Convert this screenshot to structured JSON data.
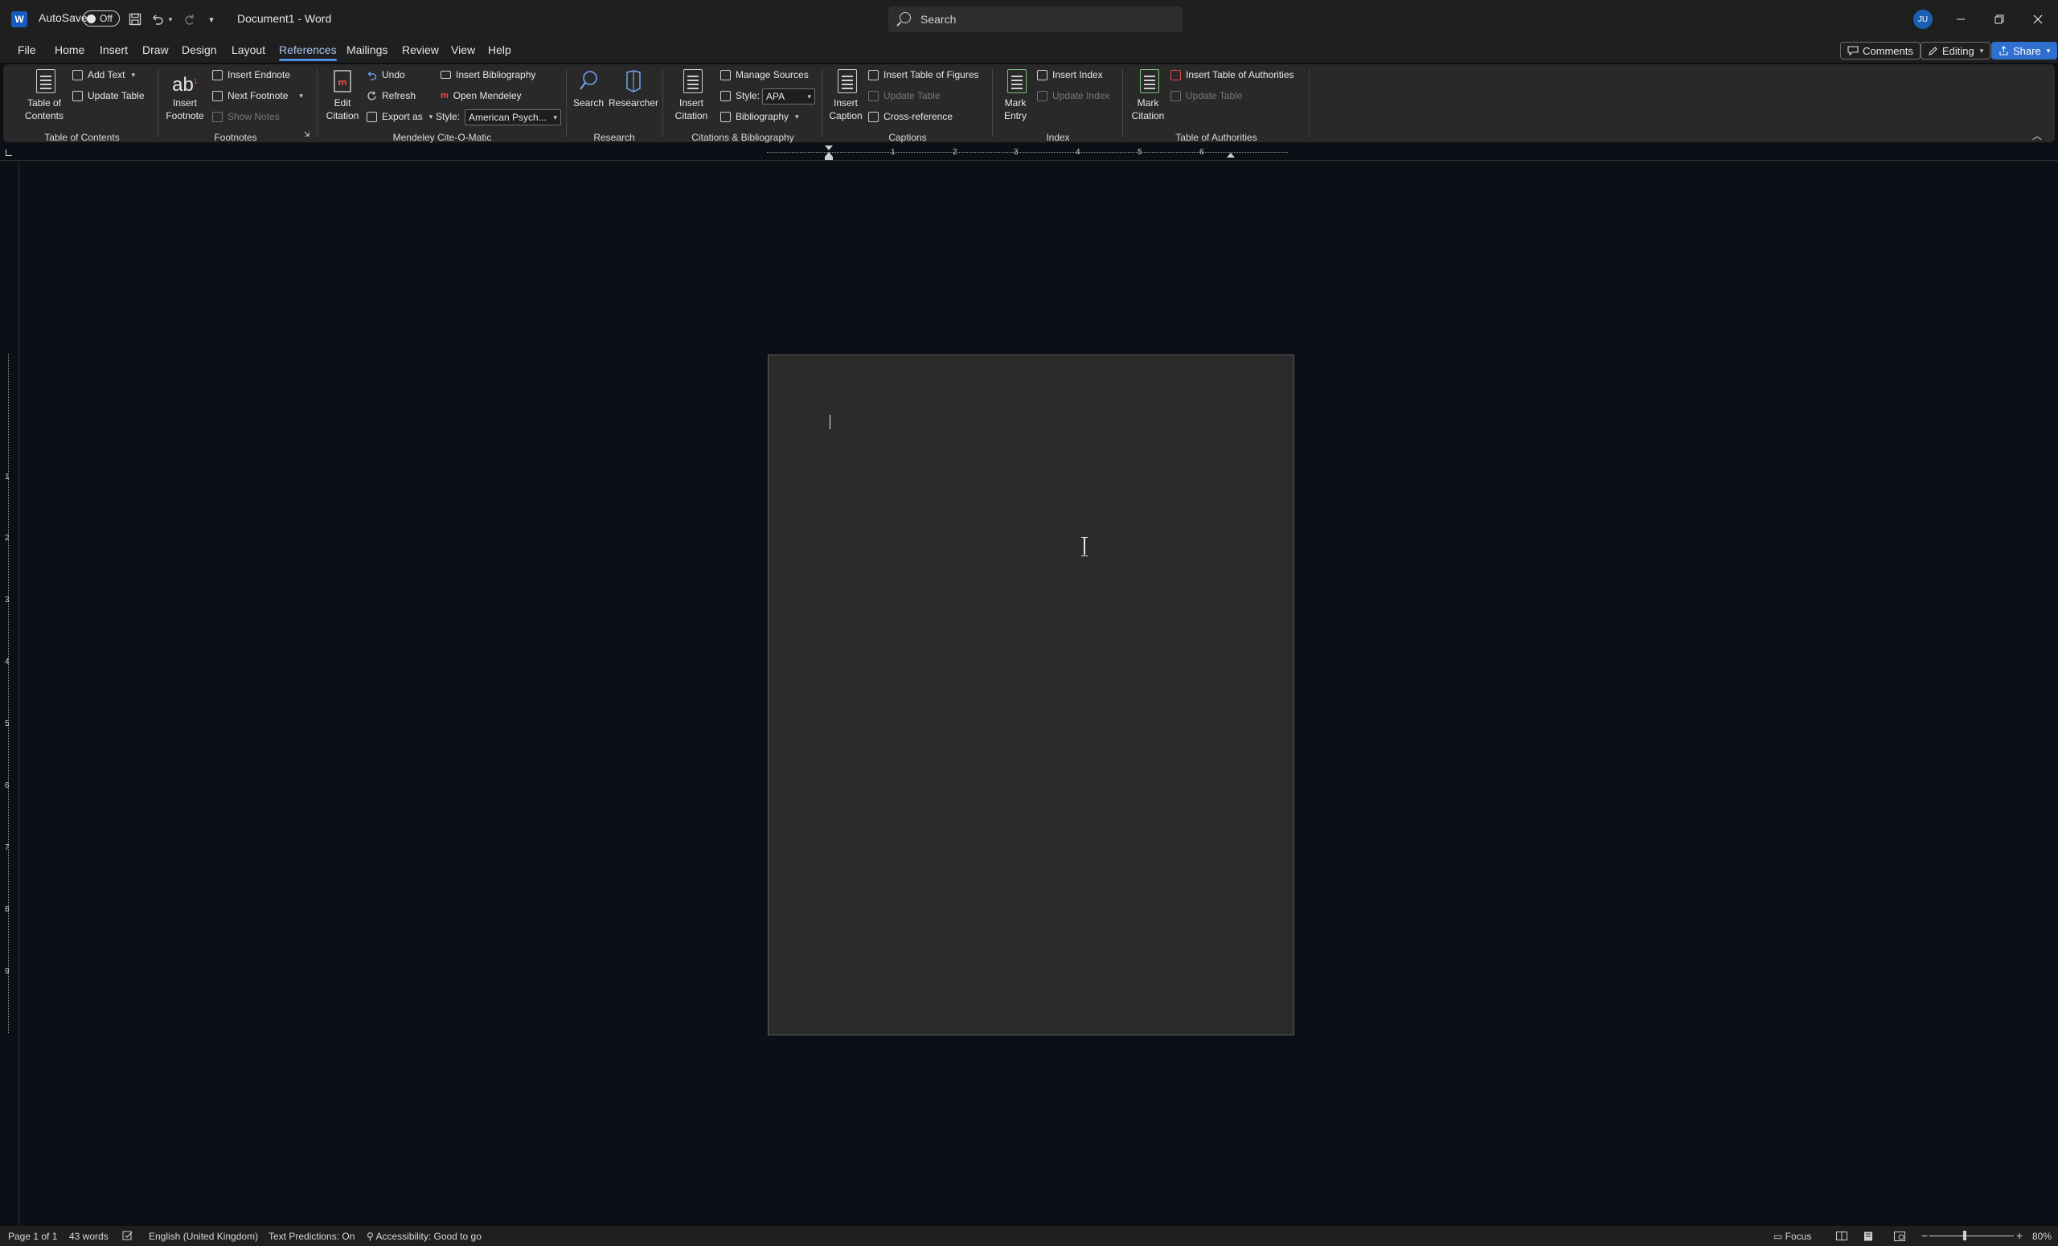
{
  "titlebar": {
    "logo": "W",
    "autosave_label": "AutoSave",
    "autosave_state": "Off",
    "doc_title": "Document1  -  Word",
    "search_placeholder": "Search",
    "avatar_initials": "JU"
  },
  "tabs": [
    "File",
    "Home",
    "Insert",
    "Draw",
    "Design",
    "Layout",
    "References",
    "Mailings",
    "Review",
    "View",
    "Help"
  ],
  "active_tab": "References",
  "top_buttons": {
    "comments": "Comments",
    "editing": "Editing",
    "share": "Share"
  },
  "ribbon": {
    "toc": {
      "label": "Table of Contents",
      "table_of_contents": "Table of\nContents",
      "add_text": "Add Text",
      "update_table": "Update Table"
    },
    "footnotes": {
      "label": "Footnotes",
      "insert_footnote": "Insert\nFootnote",
      "ab_glyph": "ab",
      "insert_endnote": "Insert Endnote",
      "next_footnote": "Next Footnote",
      "show_notes": "Show Notes"
    },
    "mendeley": {
      "label": "Mendeley Cite-O-Matic",
      "edit_citation": "Edit\nCitation",
      "undo": "Undo",
      "refresh": "Refresh",
      "export_as": "Export as",
      "insert_bibliography": "Insert Bibliography",
      "open_mendeley": "Open Mendeley",
      "style_label": "Style:",
      "style_value": "American Psych..."
    },
    "research": {
      "label": "Research",
      "search": "Search",
      "researcher": "Researcher"
    },
    "citations": {
      "label": "Citations & Bibliography",
      "insert_citation": "Insert\nCitation",
      "manage_sources": "Manage Sources",
      "style_label": "Style:",
      "style_value": "APA",
      "bibliography": "Bibliography"
    },
    "captions": {
      "label": "Captions",
      "insert_caption": "Insert\nCaption",
      "insert_table_of_figures": "Insert Table of Figures",
      "update_table": "Update Table",
      "cross_reference": "Cross-reference"
    },
    "index": {
      "label": "Index",
      "mark_entry": "Mark\nEntry",
      "insert_index": "Insert Index",
      "update_index": "Update Index"
    },
    "authorities": {
      "label": "Table of Authorities",
      "mark_citation": "Mark\nCitation",
      "insert_table_of_authorities": "Insert Table of Authorities",
      "update_table": "Update Table"
    }
  },
  "ruler": {
    "h_numbers": [
      "1",
      "2",
      "3",
      "4",
      "5",
      "6"
    ],
    "v_numbers": [
      "1",
      "2",
      "3",
      "4",
      "5",
      "6",
      "7",
      "8",
      "9"
    ]
  },
  "statusbar": {
    "page": "Page 1 of 1",
    "words": "43 words",
    "language": "English (United Kingdom)",
    "text_predictions": "Text Predictions: On",
    "accessibility": "Accessibility: Good to go",
    "focus": "Focus",
    "zoom": "80%"
  },
  "colors": {
    "accent": "#4f8fea",
    "share": "#2f6fd0",
    "background": "#0b1017",
    "page": "#2b2b2b"
  }
}
